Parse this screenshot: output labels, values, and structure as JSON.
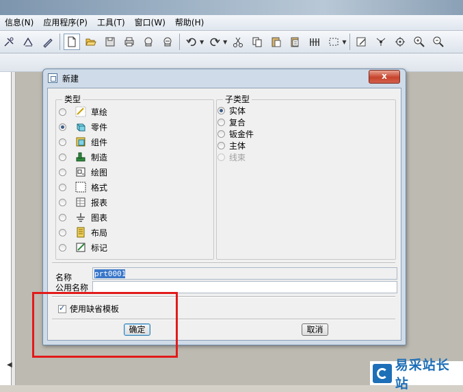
{
  "menubar": {
    "items": [
      "信息(N)",
      "应用程序(P)",
      "工具(T)",
      "窗口(W)",
      "帮助(H)"
    ]
  },
  "toolbar": {
    "icons": [
      "draw-icon",
      "datum-icon",
      "new-file-icon",
      "open-folder-icon",
      "save-icon",
      "print-icon",
      "send-icon",
      "send-alt-icon",
      "undo-icon",
      "redo-icon",
      "cut-icon",
      "copy-icon",
      "paste-icon",
      "paste-special-icon",
      "regenerate-icon",
      "select-box-icon",
      "edit-icon",
      "datum-point-icon",
      "spin-icon",
      "zoom-in-icon",
      "zoom-out-icon"
    ]
  },
  "dialog": {
    "title": "新建",
    "close_label": "x",
    "type_group": {
      "label": "类型",
      "items": [
        {
          "label": "草绘",
          "checked": false,
          "icon": "sketch-icon"
        },
        {
          "label": "零件",
          "checked": true,
          "icon": "part-icon"
        },
        {
          "label": "组件",
          "checked": false,
          "icon": "assembly-icon"
        },
        {
          "label": "制造",
          "checked": false,
          "icon": "manufacturing-icon"
        },
        {
          "label": "绘图",
          "checked": false,
          "icon": "drawing-icon"
        },
        {
          "label": "格式",
          "checked": false,
          "icon": "format-icon"
        },
        {
          "label": "报表",
          "checked": false,
          "icon": "report-icon"
        },
        {
          "label": "图表",
          "checked": false,
          "icon": "diagram-icon"
        },
        {
          "label": "布局",
          "checked": false,
          "icon": "layout-icon"
        },
        {
          "label": "标记",
          "checked": false,
          "icon": "markup-icon"
        }
      ]
    },
    "subtype_group": {
      "label": "子类型",
      "items": [
        {
          "label": "实体",
          "checked": true,
          "disabled": false
        },
        {
          "label": "复合",
          "checked": false,
          "disabled": false
        },
        {
          "label": "钣金件",
          "checked": false,
          "disabled": false
        },
        {
          "label": "主体",
          "checked": false,
          "disabled": false
        },
        {
          "label": "线束",
          "checked": false,
          "disabled": true
        }
      ]
    },
    "name_label": "名称",
    "name_value": "prt0001",
    "common_name_label": "公用名称",
    "common_name_value": "",
    "use_default_template_label": "使用缺省模板",
    "use_default_template_checked": true,
    "ok_label": "确定",
    "cancel_label": "取消"
  },
  "watermark": {
    "text": "易采站长站"
  },
  "colors": {
    "highlight": "#e21a1a",
    "selection": "#3a77c9",
    "dialog_frame": "#cfdbe8"
  }
}
